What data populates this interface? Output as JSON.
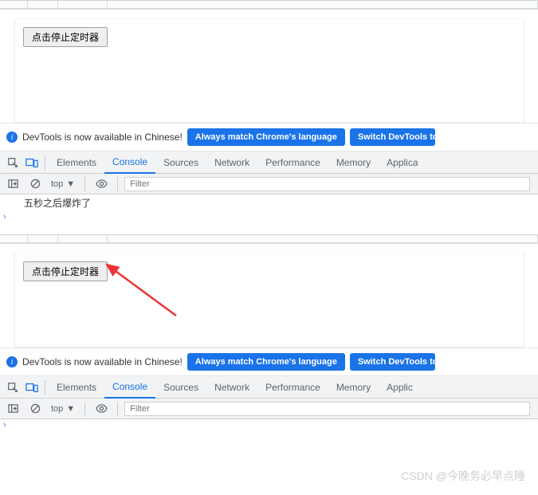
{
  "shared": {
    "stop_button_label": "点击停止定时器",
    "info_text": "DevTools is now available in Chinese!",
    "match_lang_btn": "Always match Chrome's language",
    "switch_btn_full": "Switch DevTools to Chinese",
    "switch_btn_cut1": "Switch DevTools to Ch",
    "switch_btn_cut2": "Switch DevTools to C",
    "tabs": {
      "elements": "Elements",
      "console": "Console",
      "sources": "Sources",
      "network": "Network",
      "performance": "Performance",
      "memory": "Memory",
      "application1": "Applica",
      "application2": "Applic"
    },
    "context": "top",
    "filter_placeholder": "Filter",
    "prompt": "›"
  },
  "panel1": {
    "log": "五秒之后爆炸了"
  },
  "watermark": "CSDN @今晚务必早点睡"
}
